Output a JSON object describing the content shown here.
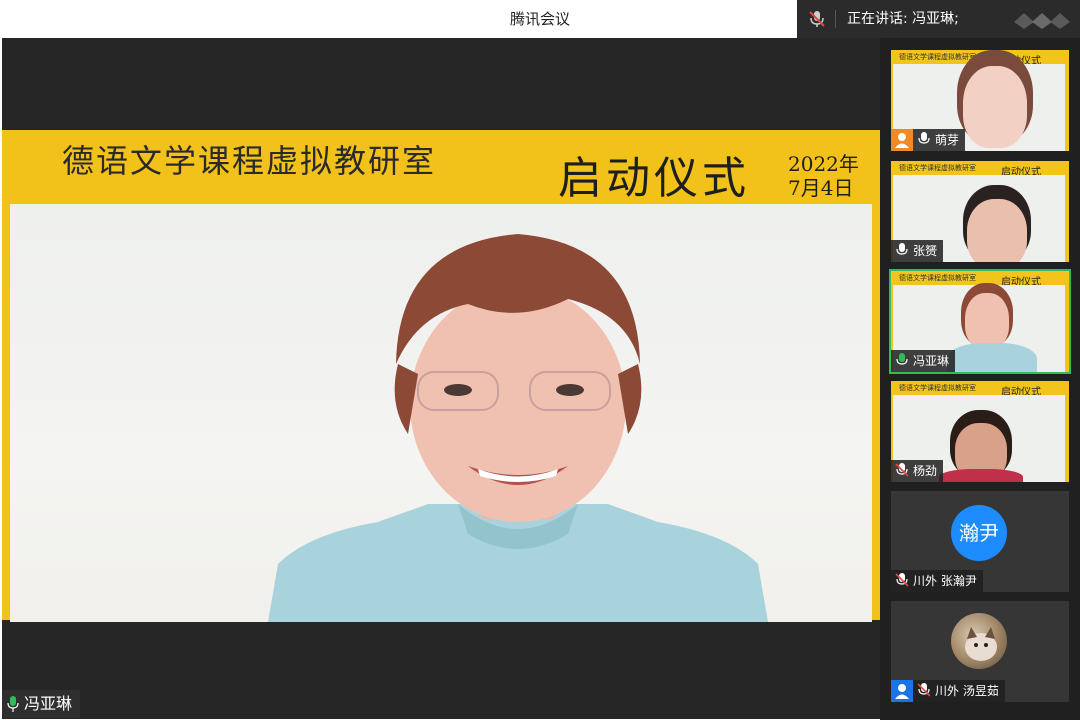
{
  "window": {
    "title": "腾讯会议"
  },
  "speaker": {
    "label": "正在讲话: 冯亚琳;"
  },
  "main": {
    "banner_title": "德语文学课程虚拟教研室",
    "banner_ceremony": "启动仪式",
    "banner_year": "2022年",
    "banner_date": "7月4日",
    "speaker_name": "冯亚琳"
  },
  "participants": [
    {
      "name": "萌芽",
      "mic": "on",
      "video": "on"
    },
    {
      "name": "张赟",
      "mic": "on",
      "video": "on"
    },
    {
      "name": "冯亚琳",
      "mic": "on",
      "video": "on",
      "speaking": true
    },
    {
      "name": "杨劲",
      "mic": "muted",
      "video": "on"
    },
    {
      "name": "川外 张瀚尹",
      "mic": "muted",
      "video": "off",
      "avatar_text": "瀚尹"
    },
    {
      "name": "川外 汤昱茹",
      "mic": "muted",
      "video": "off"
    }
  ],
  "thumb": {
    "t1": "德语文学课程虚拟教研室",
    "t2": "启动仪式"
  },
  "colors": {
    "banner": "#f2c21a",
    "active_border": "#2ebd57",
    "avatar_bg": "#1e8bff"
  }
}
